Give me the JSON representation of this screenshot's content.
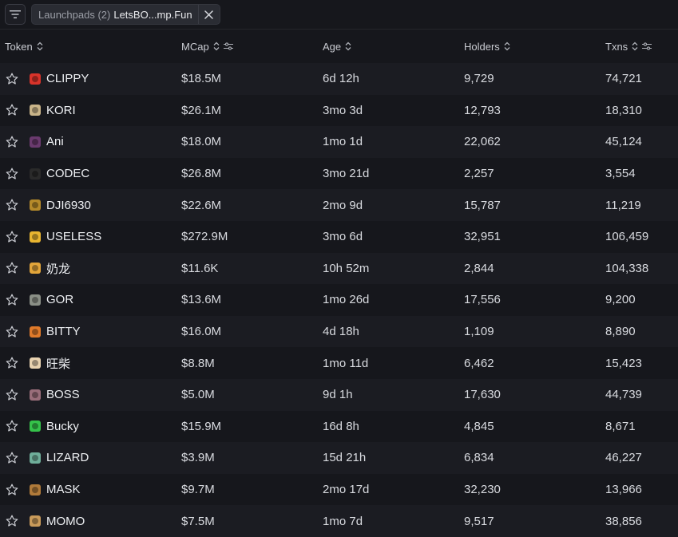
{
  "filter_bar": {
    "chip_prefix": "Launchpads (2)",
    "chip_value": "LetsBO...mp.Fun"
  },
  "table": {
    "columns": {
      "token": "Token",
      "mcap": "MCap",
      "age": "Age",
      "holders": "Holders",
      "txns": "Txns"
    },
    "rows": [
      {
        "symbol": "CLIPPY",
        "mcap": "$18.5M",
        "age": "6d 12h",
        "holders": "9,729",
        "txns": "74,721",
        "color": "#d8332a"
      },
      {
        "symbol": "KORI",
        "mcap": "$26.1M",
        "age": "3mo 3d",
        "holders": "12,793",
        "txns": "18,310",
        "color": "#c9b489"
      },
      {
        "symbol": "Ani",
        "mcap": "$18.0M",
        "age": "1mo 1d",
        "holders": "22,062",
        "txns": "45,124",
        "color": "#6a3a6e"
      },
      {
        "symbol": "CODEC",
        "mcap": "$26.8M",
        "age": "3mo 21d",
        "holders": "2,257",
        "txns": "3,554",
        "color": "#2a2a2a"
      },
      {
        "symbol": "DJI6930",
        "mcap": "$22.6M",
        "age": "2mo 9d",
        "holders": "15,787",
        "txns": "11,219",
        "color": "#b58a2a"
      },
      {
        "symbol": "USELESS",
        "mcap": "$272.9M",
        "age": "3mo 6d",
        "holders": "32,951",
        "txns": "106,459",
        "color": "#e8b530"
      },
      {
        "symbol": "奶龙",
        "mcap": "$11.6K",
        "age": "10h 52m",
        "holders": "2,844",
        "txns": "104,338",
        "color": "#e2a53a"
      },
      {
        "symbol": "GOR",
        "mcap": "$13.6M",
        "age": "1mo 26d",
        "holders": "17,556",
        "txns": "9,200",
        "color": "#8a8f86"
      },
      {
        "symbol": "BITTY",
        "mcap": "$16.0M",
        "age": "4d 18h",
        "holders": "1,109",
        "txns": "8,890",
        "color": "#e07a2a"
      },
      {
        "symbol": "旺柴",
        "mcap": "$8.8M",
        "age": "1mo 11d",
        "holders": "6,462",
        "txns": "15,423",
        "color": "#e8d2b0"
      },
      {
        "symbol": "BOSS",
        "mcap": "$5.0M",
        "age": "9d 1h",
        "holders": "17,630",
        "txns": "44,739",
        "color": "#9a6e7a"
      },
      {
        "symbol": "Bucky",
        "mcap": "$15.9M",
        "age": "16d 8h",
        "holders": "4,845",
        "txns": "8,671",
        "color": "#35c24a"
      },
      {
        "symbol": "LIZARD",
        "mcap": "$3.9M",
        "age": "15d 21h",
        "holders": "6,834",
        "txns": "46,227",
        "color": "#6fae9a"
      },
      {
        "symbol": "MASK",
        "mcap": "$9.7M",
        "age": "2mo 17d",
        "holders": "32,230",
        "txns": "13,966",
        "color": "#b07a3a"
      },
      {
        "symbol": "MOMO",
        "mcap": "$7.5M",
        "age": "1mo 7d",
        "holders": "9,517",
        "txns": "38,856",
        "color": "#c89a5a"
      }
    ]
  }
}
